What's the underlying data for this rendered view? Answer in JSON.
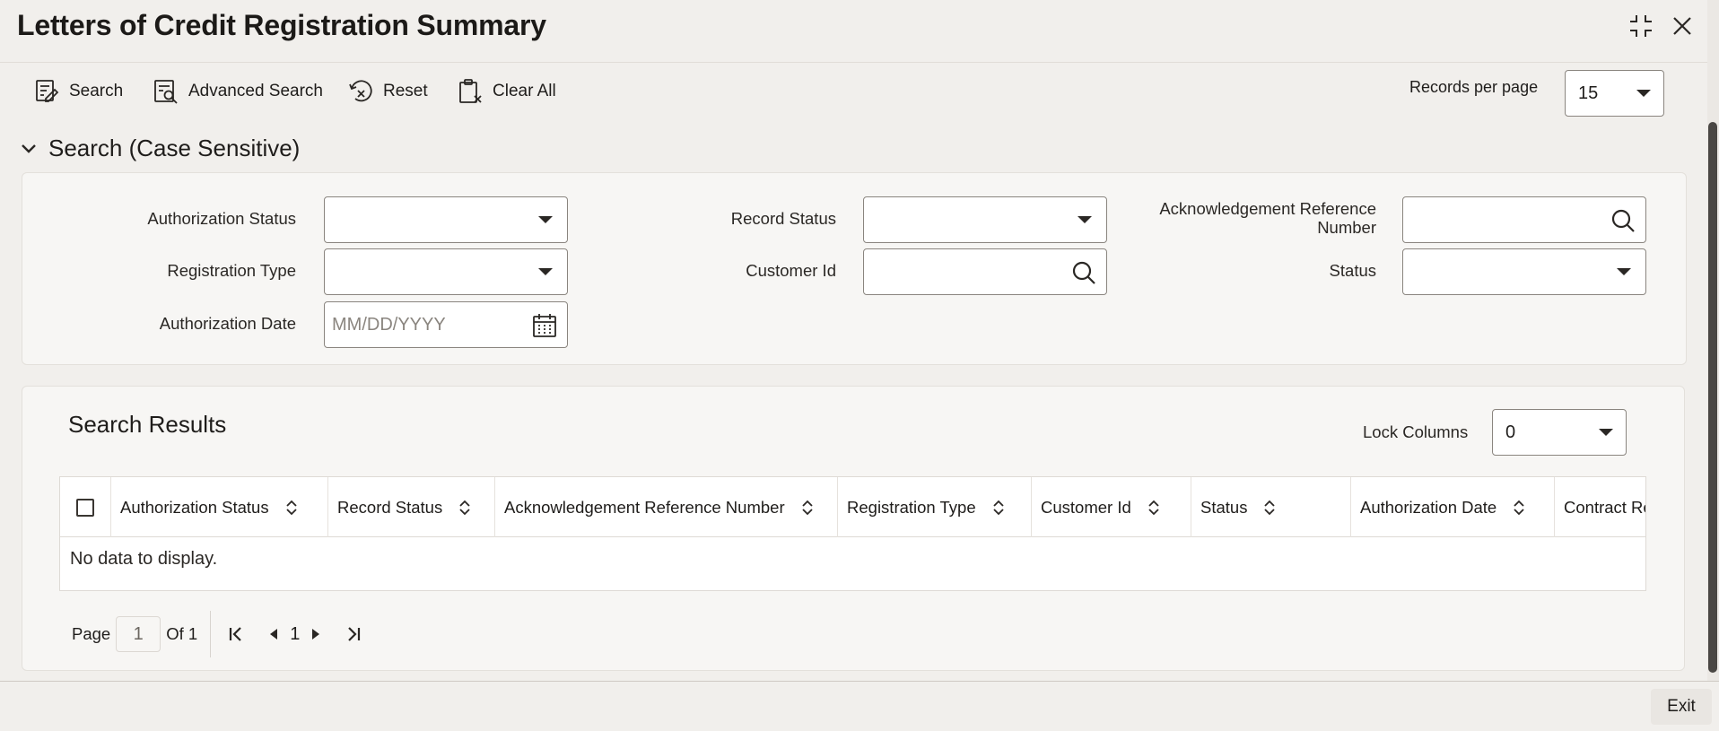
{
  "window": {
    "title": "Letters of Credit Registration Summary",
    "maximize_icon": "maximize-icon",
    "close_icon": "close-icon"
  },
  "toolbar": {
    "search_label": "Search",
    "advanced_search_label": "Advanced Search",
    "reset_label": "Reset",
    "clear_all_label": "Clear All",
    "records_per_page_label": "Records per page",
    "records_per_page_value": "15"
  },
  "search_section": {
    "title": "Search (Case Sensitive)",
    "fields": {
      "authorization_status": {
        "label": "Authorization Status",
        "value": ""
      },
      "registration_type": {
        "label": "Registration Type",
        "value": ""
      },
      "authorization_date": {
        "label": "Authorization Date",
        "placeholder": "MM/DD/YYYY"
      },
      "record_status": {
        "label": "Record Status",
        "value": ""
      },
      "customer_id": {
        "label": "Customer Id",
        "value": ""
      },
      "ack_ref_number": {
        "label_line1": "Acknowledgement Reference",
        "label_line2": "Number",
        "value": ""
      },
      "status": {
        "label": "Status",
        "value": ""
      }
    }
  },
  "results": {
    "title": "Search Results",
    "lock_columns_label": "Lock Columns",
    "lock_columns_value": "0",
    "columns": [
      "Authorization Status",
      "Record Status",
      "Acknowledgement Reference Number",
      "Registration Type",
      "Customer Id",
      "Status",
      "Authorization Date",
      "Contract Re"
    ],
    "empty_message": "No data to display.",
    "pager": {
      "page_label": "Page",
      "current_page": "1",
      "of_label": "Of 1",
      "nav_page": "1"
    }
  },
  "footer": {
    "exit_label": "Exit"
  },
  "colors": {
    "background": "#f1efec",
    "panel": "#f7f6f4",
    "border": "#8a857f",
    "text": "#1f1d1b"
  }
}
